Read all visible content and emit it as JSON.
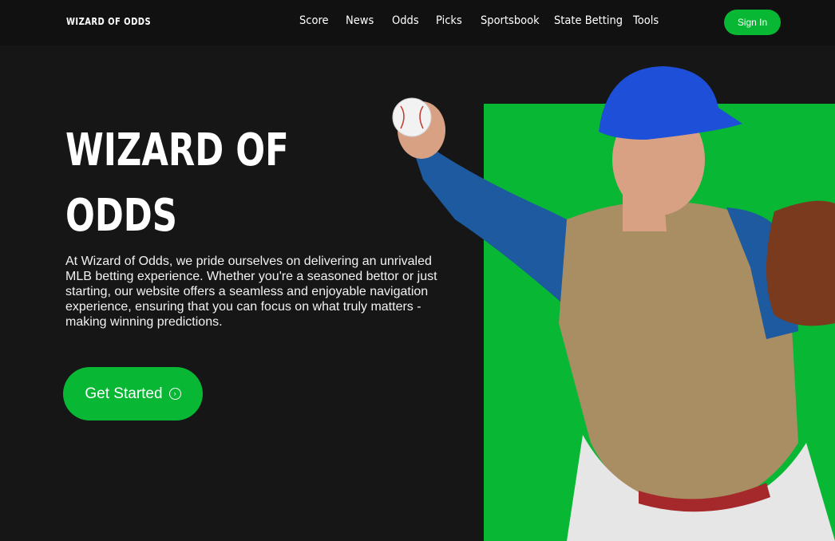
{
  "brand": {
    "logo_text": "WIZARD OF ODDS"
  },
  "nav": {
    "items": [
      {
        "label": "Score"
      },
      {
        "label": "News"
      },
      {
        "label": "Odds"
      },
      {
        "label": "Picks"
      },
      {
        "label": "Sportsbook"
      },
      {
        "label": "State Betting"
      },
      {
        "label": "Tools"
      }
    ],
    "signin_label": "Sign In"
  },
  "hero": {
    "title_line1": "WIZARD OF",
    "title_line2": "ODDS",
    "description": "At Wizard of Odds, we pride ourselves on delivering an unrivaled MLB betting experience. Whether you're a seasoned bettor or just starting, our website offers a seamless and enjoyable navigation experience, ensuring that you can focus on what truly matters - making winning predictions.",
    "cta_label": "Get Started",
    "cta_icon": "chevron-right-circle-icon"
  },
  "colors": {
    "accent": "#08b733",
    "background": "#161616",
    "nav_background": "#111111"
  }
}
